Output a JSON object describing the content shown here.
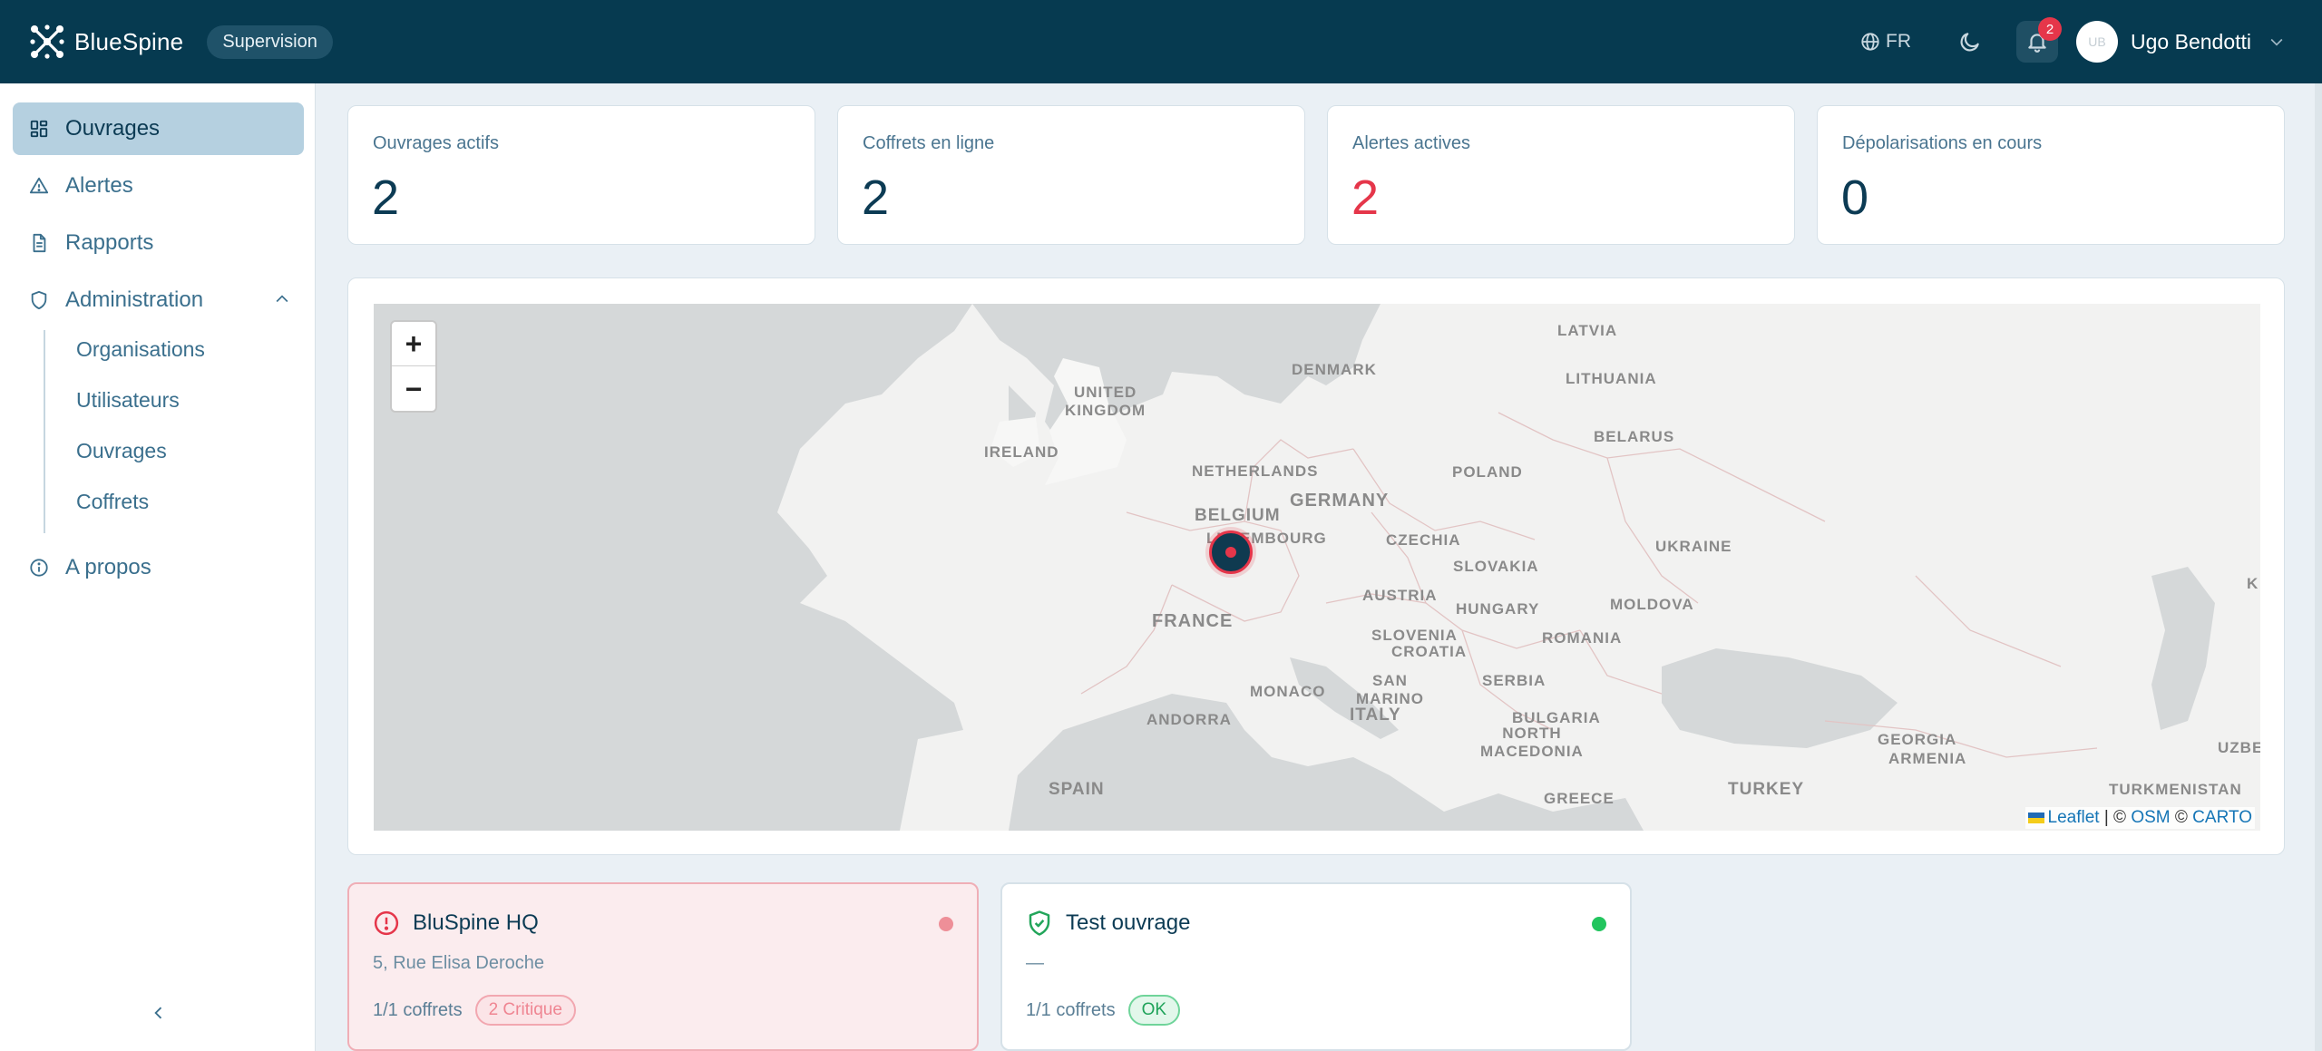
{
  "app": {
    "name": "BlueSpine",
    "mode_badge": "Supervision"
  },
  "header": {
    "language": "FR",
    "notifications_count": "2",
    "user": {
      "initials": "UB",
      "name": "Ugo Bendotti"
    }
  },
  "sidebar": {
    "items": [
      {
        "label": "Ouvrages",
        "icon": "grid-icon",
        "active": true
      },
      {
        "label": "Alertes",
        "icon": "warning-triangle-icon"
      },
      {
        "label": "Rapports",
        "icon": "document-icon"
      },
      {
        "label": "Administration",
        "icon": "shield-icon",
        "expanded": true
      },
      {
        "label": "A propos",
        "icon": "info-icon"
      }
    ],
    "admin_subitems": [
      {
        "label": "Organisations"
      },
      {
        "label": "Utilisateurs"
      },
      {
        "label": "Ouvrages"
      },
      {
        "label": "Coffrets"
      }
    ]
  },
  "stats": [
    {
      "label": "Ouvrages actifs",
      "value": "2"
    },
    {
      "label": "Coffrets en ligne",
      "value": "2"
    },
    {
      "label": "Alertes actives",
      "value": "2",
      "status_color": "#e5364a"
    },
    {
      "label": "Dépolarisations en cours",
      "value": "0"
    }
  ],
  "map": {
    "zoom_in": "+",
    "zoom_out": "−",
    "labels": [
      {
        "text": "LATVIA"
      },
      {
        "text": "DENMARK"
      },
      {
        "text": "LITHUANIA"
      },
      {
        "text": "UNITED\nKINGDOM"
      },
      {
        "text": "BELARUS"
      },
      {
        "text": "IRELAND"
      },
      {
        "text": "NETHERLANDS"
      },
      {
        "text": "POLAND"
      },
      {
        "text": "GERMANY"
      },
      {
        "text": "BELGIUM"
      },
      {
        "text": "LUXEMBOURG"
      },
      {
        "text": "CZECHIA"
      },
      {
        "text": "UKRAINE"
      },
      {
        "text": "SLOVAKIA"
      },
      {
        "text": "AUSTRIA"
      },
      {
        "text": "HUNGARY"
      },
      {
        "text": "MOLDOVA"
      },
      {
        "text": "FRANCE"
      },
      {
        "text": "SLOVENIA"
      },
      {
        "text": "CROATIA"
      },
      {
        "text": "ROMANIA"
      },
      {
        "text": "SERBIA"
      },
      {
        "text": "MONACO"
      },
      {
        "text": "SAN\nMARINO"
      },
      {
        "text": "ITALY"
      },
      {
        "text": "ANDORRA"
      },
      {
        "text": "BULGARIA"
      },
      {
        "text": "NORTH\nMACEDONIA"
      },
      {
        "text": "GEORGIA"
      },
      {
        "text": "ARMENIA"
      },
      {
        "text": "SPAIN"
      },
      {
        "text": "GREECE"
      },
      {
        "text": "TURKEY"
      },
      {
        "text": "TURKMENISTAN"
      },
      {
        "text": "UZBEK"
      },
      {
        "text": "K"
      }
    ],
    "attribution": {
      "leaflet": "Leaflet",
      "sep1": " | © ",
      "osm": "OSM",
      "sep2": " © ",
      "carto": "CARTO"
    }
  },
  "sites": [
    {
      "name": "BluSpine HQ",
      "address": "5, Rue Elisa Deroche",
      "coffrets": "1/1 coffrets",
      "status_label": "2 Critique",
      "status": "critical",
      "dot_color": "#ee8f98"
    },
    {
      "name": "Test ouvrage",
      "address": "—",
      "coffrets": "1/1 coffrets",
      "status_label": "OK",
      "status": "ok",
      "dot_color": "#22c55e"
    }
  ],
  "colors": {
    "topbar": "#063a50",
    "accent": "#b5d0e0",
    "critical": "#e5364a",
    "ok": "#22c55e"
  }
}
